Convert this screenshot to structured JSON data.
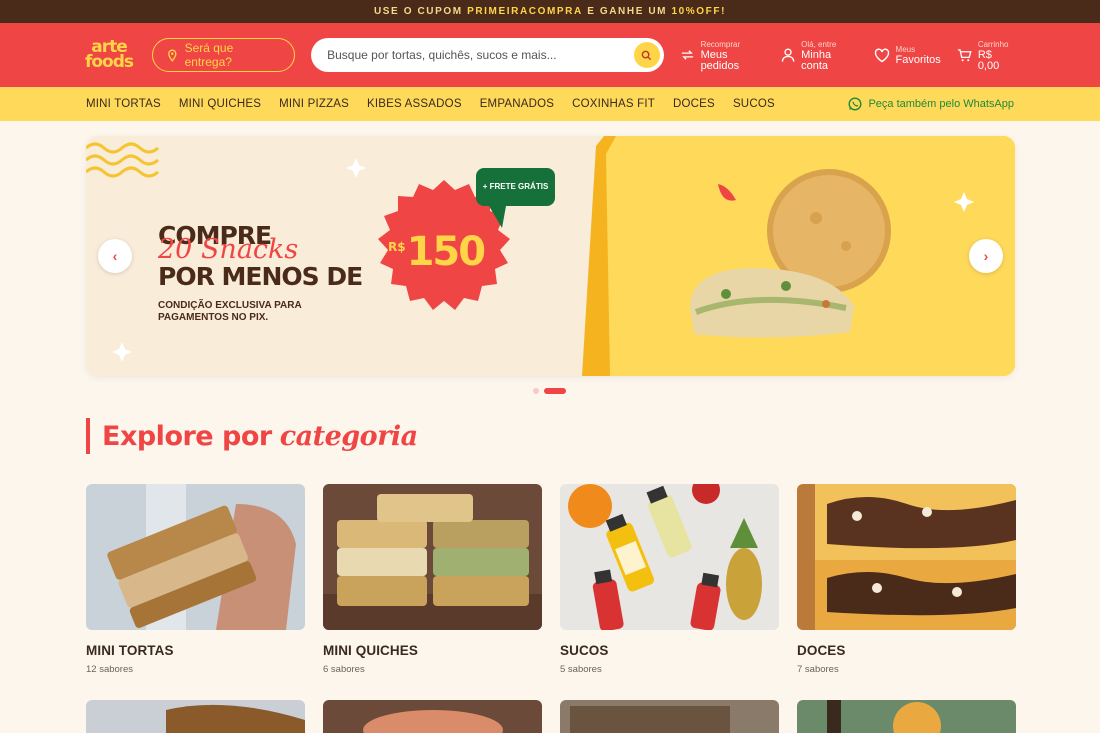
{
  "promo_bar": {
    "prefix": "USE O CUPOM ",
    "code": "PRIMEIRACOMPRA",
    "middle": " E GANHE UM ",
    "discount": "10%OFF!"
  },
  "header": {
    "logo_line1": "arte",
    "logo_line2": "foods",
    "deliver_label": "Será que entrega?",
    "search_placeholder": "Busque por tortas, quichês, sucos e mais...",
    "nav": [
      {
        "small": "Recomprar",
        "big": "Meus pedidos",
        "icon": "repeat-icon"
      },
      {
        "small": "Olá, entre",
        "big": "Minha conta",
        "icon": "user-icon"
      },
      {
        "small": "Meus",
        "big": "Favoritos",
        "icon": "heart-icon"
      },
      {
        "small": "Carrinho",
        "big": "R$ 0,00",
        "icon": "cart-icon"
      }
    ]
  },
  "category_nav": {
    "items": [
      "MINI TORTAS",
      "MINI QUICHES",
      "MINI PIZZAS",
      "KIBES ASSADOS",
      "EMPANADOS",
      "COXINHAS FIT",
      "DOCES",
      "SUCOS"
    ],
    "whatsapp_label": "Peça também pelo WhatsApp"
  },
  "hero": {
    "line1": "COMPRE",
    "line2": "20 Snacks",
    "line3": "POR MENOS DE",
    "badge_currency": "R$",
    "badge_value": "150",
    "frete": "+ FRETE GRÁTIS",
    "condition": "CONDIÇÃO EXCLUSIVA PARA PAGAMENTOS NO PIX."
  },
  "carousel": {
    "slides": 2,
    "active": 2
  },
  "section": {
    "title": "Explore por",
    "title_italic": "categoria"
  },
  "categories": [
    {
      "name": "MINI TORTAS",
      "count": "12 sabores"
    },
    {
      "name": "MINI QUICHES",
      "count": "6 sabores"
    },
    {
      "name": "SUCOS",
      "count": "5 sabores"
    },
    {
      "name": "DOCES",
      "count": "7 sabores"
    }
  ],
  "colors": {
    "primary_red": "#f04545",
    "yellow": "#ffd95a",
    "brown": "#4a2a18",
    "cream": "#fcf6ec",
    "whatsapp_green": "#1f8a3a"
  }
}
